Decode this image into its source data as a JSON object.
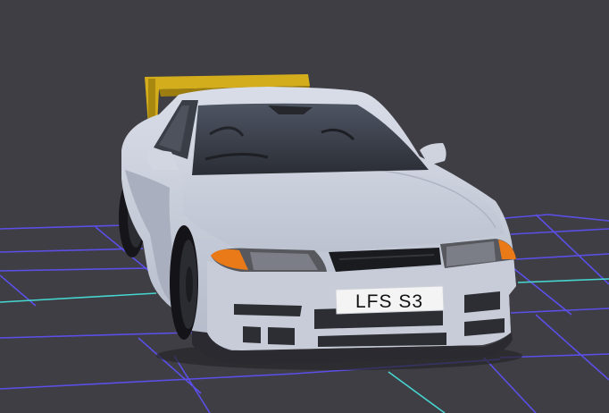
{
  "scene": {
    "kind": "3d-car-preview",
    "background_color": "#3f3e44",
    "grid": {
      "line_color": "#5b4fe8",
      "axis_color": "#46d6d0"
    },
    "car": {
      "body_color": "#c2c8d6",
      "spoiler_color": "#d4ad1c",
      "plate_text": "LFS S3"
    }
  }
}
